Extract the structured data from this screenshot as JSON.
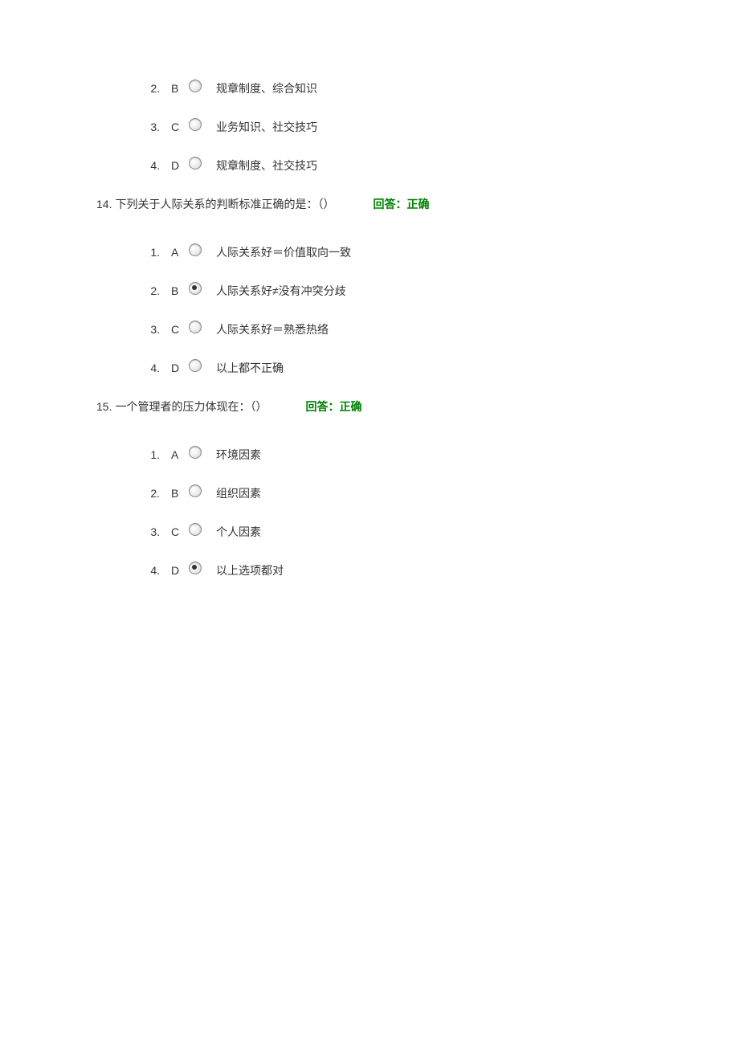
{
  "questions": [
    {
      "number": "",
      "text": "",
      "answer": "",
      "options": [
        {
          "num": "2.",
          "letter": "B",
          "selected": false,
          "text": "规章制度、综合知识"
        },
        {
          "num": "3.",
          "letter": "C",
          "selected": false,
          "text": "业务知识、社交技巧"
        },
        {
          "num": "4.",
          "letter": "D",
          "selected": false,
          "text": "规章制度、社交技巧"
        }
      ]
    },
    {
      "number": "14.",
      "text": "下列关于人际关系的判断标准正确的是：（）",
      "answer": "回答：正确",
      "options": [
        {
          "num": "1.",
          "letter": "A",
          "selected": false,
          "text": "人际关系好＝价值取向一致"
        },
        {
          "num": "2.",
          "letter": "B",
          "selected": true,
          "text": "人际关系好≠没有冲突分歧"
        },
        {
          "num": "3.",
          "letter": "C",
          "selected": false,
          "text": "人际关系好＝熟悉热络"
        },
        {
          "num": "4.",
          "letter": "D",
          "selected": false,
          "text": "以上都不正确"
        }
      ]
    },
    {
      "number": "15.",
      "text": "一个管理者的压力体现在：（）",
      "answer": "回答：正确",
      "options": [
        {
          "num": "1.",
          "letter": "A",
          "selected": false,
          "text": "环境因素"
        },
        {
          "num": "2.",
          "letter": "B",
          "selected": false,
          "text": "组织因素"
        },
        {
          "num": "3.",
          "letter": "C",
          "selected": false,
          "text": "个人因素"
        },
        {
          "num": "4.",
          "letter": "D",
          "selected": true,
          "text": "以上选项都对"
        }
      ]
    }
  ]
}
